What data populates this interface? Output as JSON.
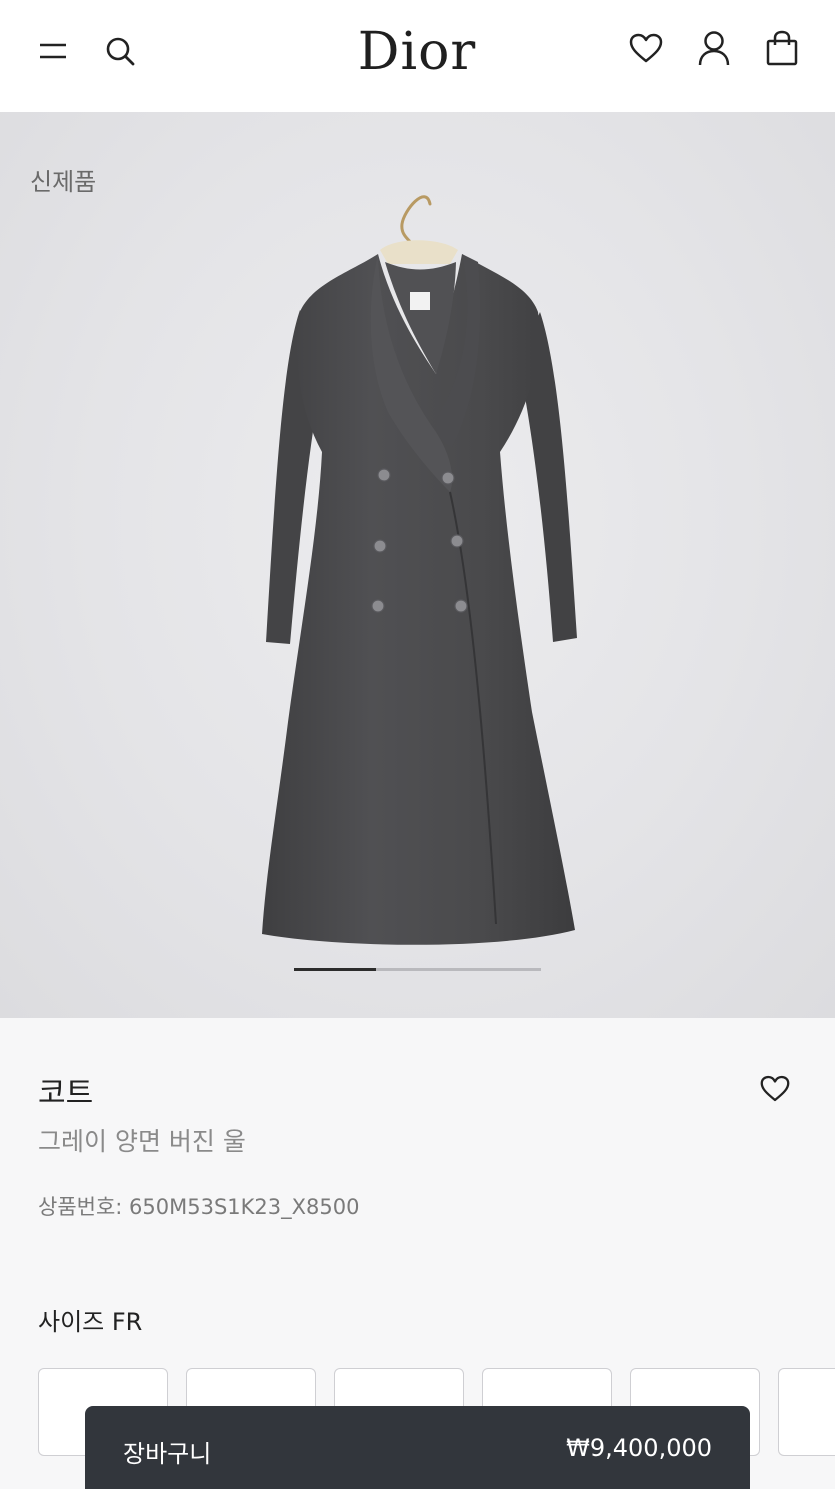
{
  "header": {
    "logo": "Dior",
    "icons": [
      "menu-icon",
      "search-icon",
      "heart-icon",
      "account-icon",
      "bag-icon"
    ]
  },
  "hero": {
    "badge": "신제품",
    "gallery_progress": 0.33
  },
  "product": {
    "title": "코트",
    "subtitle": "그레이 양면 버진 울",
    "sku": "상품번호: 650M53S1K23_X8500"
  },
  "size": {
    "label": "사이즈 FR"
  },
  "cart": {
    "label": "장바구니",
    "price": "₩9,400,000"
  },
  "colors": {
    "coat": "#4a4a4c",
    "cart_bar": "#32363c",
    "hero_bg": "#e4e4e7"
  }
}
